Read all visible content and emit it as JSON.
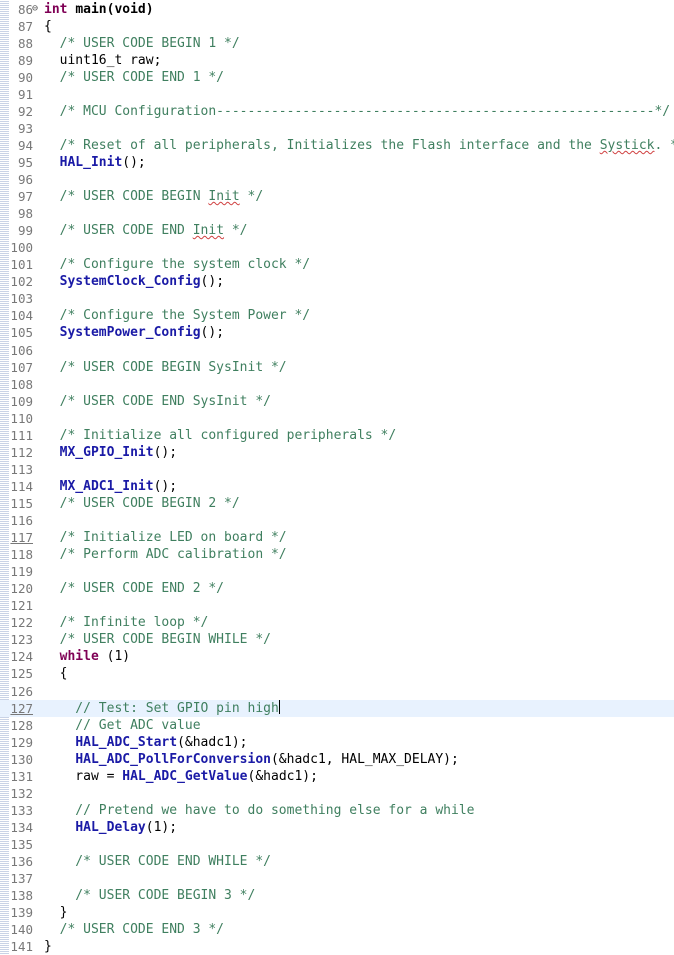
{
  "editor": {
    "lines": [
      {
        "num": "86",
        "marker": "⊖",
        "segments": [
          {
            "t": "kw",
            "v": "int"
          },
          {
            "t": "pl",
            "v": " "
          },
          {
            "t": "kwb",
            "v": "main(void)"
          }
        ]
      },
      {
        "num": "87",
        "segments": [
          {
            "t": "pl",
            "v": "{"
          }
        ]
      },
      {
        "num": "88",
        "segments": [
          {
            "t": "cm",
            "v": "  /* USER CODE BEGIN 1 */"
          }
        ]
      },
      {
        "num": "89",
        "segments": [
          {
            "t": "pl",
            "v": "  uint16_t raw;"
          }
        ]
      },
      {
        "num": "90",
        "segments": [
          {
            "t": "cm",
            "v": "  /* USER CODE END 1 */"
          }
        ]
      },
      {
        "num": "91",
        "segments": []
      },
      {
        "num": "92",
        "segments": [
          {
            "t": "cm",
            "v": "  /* MCU Configuration--------------------------------------------------------*/"
          }
        ]
      },
      {
        "num": "93",
        "segments": []
      },
      {
        "num": "94",
        "segments": [
          {
            "t": "cm",
            "v": "  /* Reset of all peripherals, Initializes the Flash interface and the "
          },
          {
            "t": "cms",
            "v": "Systick"
          },
          {
            "t": "cm",
            "v": ". */"
          }
        ]
      },
      {
        "num": "95",
        "segments": [
          {
            "t": "pl",
            "v": "  "
          },
          {
            "t": "fn",
            "v": "HAL_Init"
          },
          {
            "t": "pl",
            "v": "();"
          }
        ]
      },
      {
        "num": "96",
        "segments": []
      },
      {
        "num": "97",
        "segments": [
          {
            "t": "cm",
            "v": "  /* USER CODE BEGIN "
          },
          {
            "t": "cms",
            "v": "Init"
          },
          {
            "t": "cm",
            "v": " */"
          }
        ]
      },
      {
        "num": "98",
        "segments": []
      },
      {
        "num": "99",
        "segments": [
          {
            "t": "cm",
            "v": "  /* USER CODE END "
          },
          {
            "t": "cms",
            "v": "Init"
          },
          {
            "t": "cm",
            "v": " */"
          }
        ]
      },
      {
        "num": "100",
        "segments": []
      },
      {
        "num": "101",
        "segments": [
          {
            "t": "cm",
            "v": "  /* Configure the system clock */"
          }
        ]
      },
      {
        "num": "102",
        "segments": [
          {
            "t": "pl",
            "v": "  "
          },
          {
            "t": "fn",
            "v": "SystemClock_Config"
          },
          {
            "t": "pl",
            "v": "();"
          }
        ]
      },
      {
        "num": "103",
        "segments": []
      },
      {
        "num": "104",
        "segments": [
          {
            "t": "cm",
            "v": "  /* Configure the System Power */"
          }
        ]
      },
      {
        "num": "105",
        "segments": [
          {
            "t": "pl",
            "v": "  "
          },
          {
            "t": "fn",
            "v": "SystemPower_Config"
          },
          {
            "t": "pl",
            "v": "();"
          }
        ]
      },
      {
        "num": "106",
        "segments": []
      },
      {
        "num": "107",
        "segments": [
          {
            "t": "cm",
            "v": "  /* USER CODE BEGIN SysInit */"
          }
        ]
      },
      {
        "num": "108",
        "segments": []
      },
      {
        "num": "109",
        "segments": [
          {
            "t": "cm",
            "v": "  /* USER CODE END SysInit */"
          }
        ]
      },
      {
        "num": "110",
        "segments": []
      },
      {
        "num": "111",
        "segments": [
          {
            "t": "cm",
            "v": "  /* Initialize all configured peripherals */"
          }
        ]
      },
      {
        "num": "112",
        "segments": [
          {
            "t": "pl",
            "v": "  "
          },
          {
            "t": "fn",
            "v": "MX_GPIO_Init"
          },
          {
            "t": "pl",
            "v": "();"
          }
        ]
      },
      {
        "num": "113",
        "segments": []
      },
      {
        "num": "114",
        "segments": [
          {
            "t": "pl",
            "v": "  "
          },
          {
            "t": "fn",
            "v": "MX_ADC1_Init"
          },
          {
            "t": "pl",
            "v": "();"
          }
        ]
      },
      {
        "num": "115",
        "segments": [
          {
            "t": "cm",
            "v": "  /* USER CODE BEGIN 2 */"
          }
        ]
      },
      {
        "num": "116",
        "segments": []
      },
      {
        "num": "117",
        "underline": true,
        "segments": [
          {
            "t": "cm",
            "v": "  /* Initialize LED on board */"
          }
        ]
      },
      {
        "num": "118",
        "segments": [
          {
            "t": "cm",
            "v": "  /* Perform ADC calibration */"
          }
        ]
      },
      {
        "num": "119",
        "segments": []
      },
      {
        "num": "120",
        "segments": [
          {
            "t": "cm",
            "v": "  /* USER CODE END 2 */"
          }
        ]
      },
      {
        "num": "121",
        "segments": []
      },
      {
        "num": "122",
        "segments": [
          {
            "t": "cm",
            "v": "  /* Infinite loop */"
          }
        ]
      },
      {
        "num": "123",
        "segments": [
          {
            "t": "cm",
            "v": "  /* USER CODE BEGIN WHILE */"
          }
        ]
      },
      {
        "num": "124",
        "segments": [
          {
            "t": "pl",
            "v": "  "
          },
          {
            "t": "kw",
            "v": "while"
          },
          {
            "t": "pl",
            "v": " (1)"
          }
        ]
      },
      {
        "num": "125",
        "segments": [
          {
            "t": "pl",
            "v": "  {"
          }
        ]
      },
      {
        "num": "126",
        "segments": []
      },
      {
        "num": "127",
        "current": true,
        "underline": true,
        "segments": [
          {
            "t": "cm",
            "v": "    // Test: Set GPIO pin high"
          },
          {
            "t": "caret",
            "v": ""
          }
        ]
      },
      {
        "num": "128",
        "segments": [
          {
            "t": "cm",
            "v": "    // Get ADC value"
          }
        ]
      },
      {
        "num": "129",
        "segments": [
          {
            "t": "pl",
            "v": "    "
          },
          {
            "t": "fn",
            "v": "HAL_ADC_Start"
          },
          {
            "t": "pl",
            "v": "(&hadc1);"
          }
        ]
      },
      {
        "num": "130",
        "segments": [
          {
            "t": "pl",
            "v": "    "
          },
          {
            "t": "fn",
            "v": "HAL_ADC_PollForConversion"
          },
          {
            "t": "pl",
            "v": "(&hadc1, HAL_MAX_DELAY);"
          }
        ]
      },
      {
        "num": "131",
        "segments": [
          {
            "t": "pl",
            "v": "    raw = "
          },
          {
            "t": "fn",
            "v": "HAL_ADC_GetValue"
          },
          {
            "t": "pl",
            "v": "(&hadc1);"
          }
        ]
      },
      {
        "num": "132",
        "segments": []
      },
      {
        "num": "133",
        "segments": [
          {
            "t": "cm",
            "v": "    // Pretend we have to do something else for a while"
          }
        ]
      },
      {
        "num": "134",
        "segments": [
          {
            "t": "pl",
            "v": "    "
          },
          {
            "t": "fn",
            "v": "HAL_Delay"
          },
          {
            "t": "pl",
            "v": "(1);"
          }
        ]
      },
      {
        "num": "135",
        "segments": []
      },
      {
        "num": "136",
        "segments": [
          {
            "t": "cm",
            "v": "    /* USER CODE END WHILE */"
          }
        ]
      },
      {
        "num": "137",
        "segments": []
      },
      {
        "num": "138",
        "segments": [
          {
            "t": "cm",
            "v": "    /* USER CODE BEGIN 3 */"
          }
        ]
      },
      {
        "num": "139",
        "segments": [
          {
            "t": "pl",
            "v": "  }"
          }
        ]
      },
      {
        "num": "140",
        "segments": [
          {
            "t": "cm",
            "v": "  /* USER CODE END 3 */"
          }
        ]
      },
      {
        "num": "141",
        "segments": [
          {
            "t": "pl",
            "v": "}"
          }
        ]
      }
    ]
  }
}
